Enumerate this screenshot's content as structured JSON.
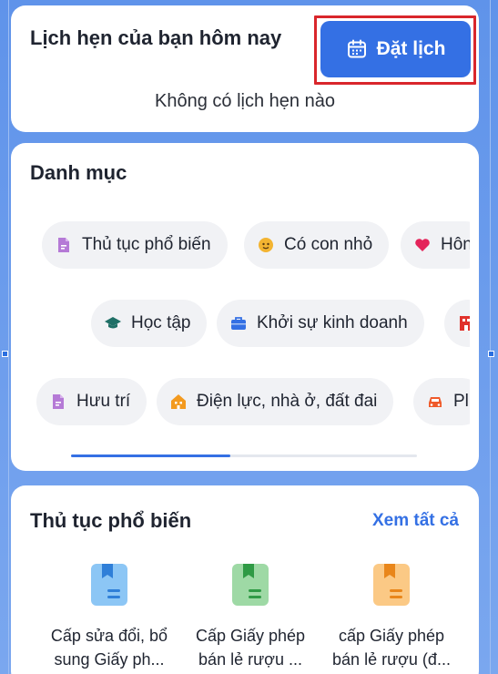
{
  "appointment": {
    "title": "Lịch hẹn của bạn hôm nay",
    "book_label": "Đặt lịch",
    "empty": "Không có lịch hẹn nào"
  },
  "categories": {
    "title": "Danh mục",
    "rows": [
      [
        {
          "label": "Thủ tục phổ biến",
          "icon": "document-icon",
          "color": "#b57ad6"
        },
        {
          "label": "Có con nhỏ",
          "icon": "baby-icon",
          "color": "#f3b431"
        },
        {
          "label": "Hôn",
          "icon": "heart-icon",
          "color": "#e4245a"
        }
      ],
      [
        {
          "label": "Học tập",
          "icon": "graduation-cap-icon",
          "color": "#1f6f66"
        },
        {
          "label": "Khởi sự kinh doanh",
          "icon": "briefcase-icon",
          "color": "#3470e4"
        },
        {
          "label": "",
          "icon": "building-icon",
          "color": "#e0312b"
        }
      ],
      [
        {
          "label": "Hưu trí",
          "icon": "document-icon",
          "color": "#b57ad6"
        },
        {
          "label": "Điện lực, nhà ở, đất đai",
          "icon": "house-icon",
          "color": "#f39a1f"
        },
        {
          "label": "Pl",
          "icon": "car-icon",
          "color": "#ef5a2a"
        }
      ]
    ],
    "scroll_progress": 0.46
  },
  "popular": {
    "title": "Thủ tục phổ biến",
    "see_all": "Xem tất cả",
    "items": [
      {
        "line1": "Cấp sửa đổi, bổ",
        "line2": "sung Giấy ph...",
        "color": "#5aa9ef"
      },
      {
        "line1": "Cấp Giấy phép",
        "line2": "bán lẻ rượu ...",
        "color": "#5dbf6a"
      },
      {
        "line1": "cấp Giấy phép",
        "line2": "bán lẻ rượu (đ...",
        "color": "#f5a23a"
      }
    ]
  }
}
